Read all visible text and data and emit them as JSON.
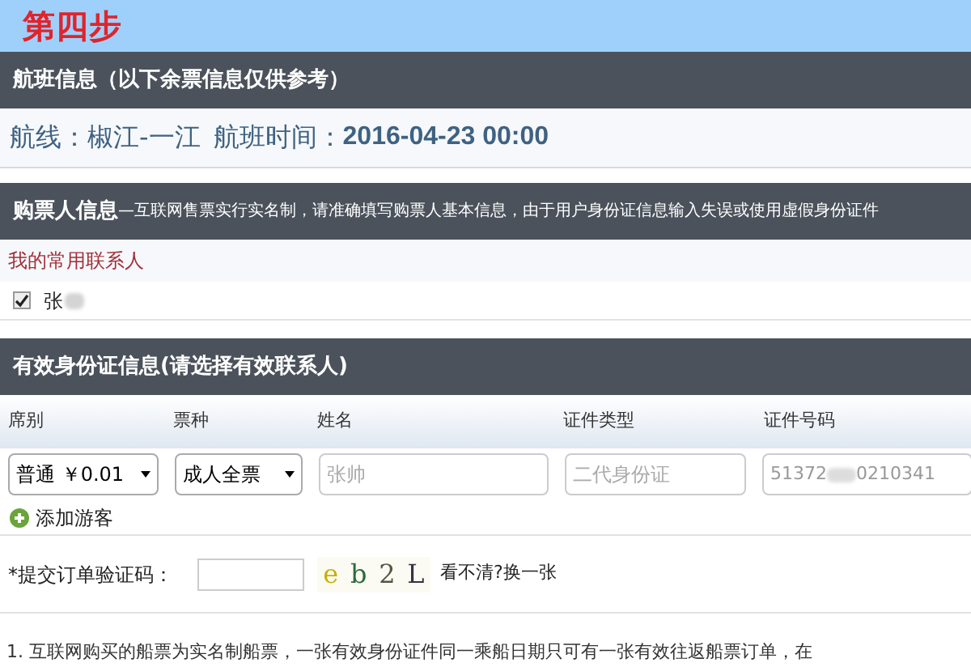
{
  "step_title": "第四步",
  "flight_section": {
    "title": "航班信息（以下余票信息仅供参考）",
    "route_label": "航线：",
    "route": "椒江-一江",
    "time_label": "航班时间：",
    "time": "2016-04-23 00:00"
  },
  "buyer_section": {
    "title": "购票人信息",
    "notice": "—互联网售票实行实名制，请准确填写购票人基本信息，由于用户身份证信息输入失误或使用虚假身份证件"
  },
  "contacts": {
    "title": "我的常用联系人",
    "items": [
      {
        "name": "张",
        "redacted": true,
        "checked": true
      }
    ]
  },
  "id_section": {
    "title": "有效身份证信息(请选择有效联系人)",
    "columns": [
      "席别",
      "票种",
      "姓名",
      "证件类型",
      "证件号码"
    ],
    "passengers": [
      {
        "seat": "普通 ￥0.01",
        "ticket_type": "成人全票",
        "name_placeholder": "张帅",
        "id_type_placeholder": "二代身份证",
        "id_number_start": "51372",
        "id_number_end": "0210341"
      }
    ],
    "add_button": "添加游客"
  },
  "captcha": {
    "label": "*提交订单验证码：",
    "code": [
      "e",
      "b",
      "2",
      "L"
    ],
    "refresh_link": "看不清?换一张"
  },
  "notes": [
    "1. 互联网购买的船票为实名制船票，一张有效身份证件同一乘船日期只可有一张有效往返船票订单，在"
  ]
}
